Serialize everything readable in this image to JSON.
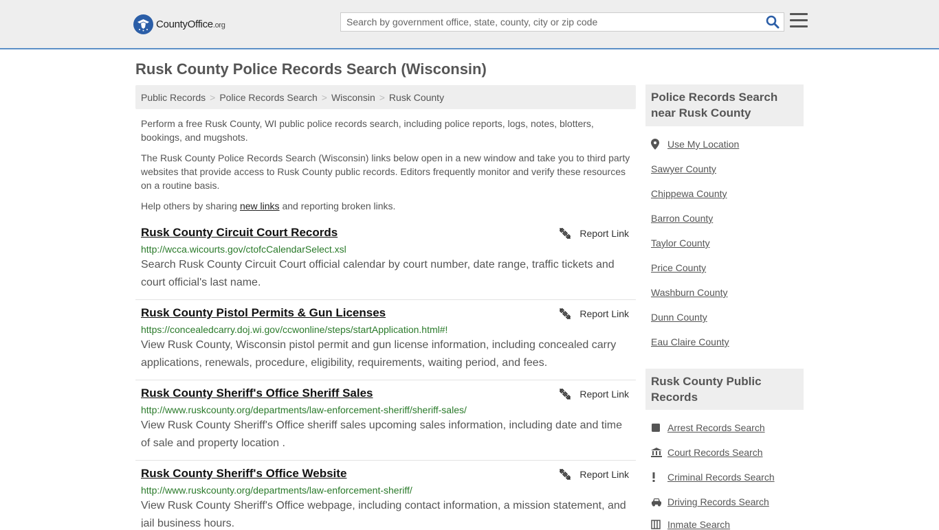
{
  "header": {
    "logo_text": "CountyOffice",
    "logo_suffix": ".org",
    "search_placeholder": "Search by government office, state, county, city or zip code"
  },
  "page_title": "Rusk County Police Records Search (Wisconsin)",
  "breadcrumb": [
    "Public Records",
    "Police Records Search",
    "Wisconsin",
    "Rusk County"
  ],
  "intro": {
    "p1": "Perform a free Rusk County, WI public police records search, including police reports, logs, notes, blotters, bookings, and mugshots.",
    "p2": "The Rusk County Police Records Search (Wisconsin) links below open in a new window and take you to third party websites that provide access to Rusk County public records. Editors frequently monitor and verify these resources on a routine basis.",
    "p3_before": "Help others by sharing ",
    "p3_link": "new links",
    "p3_after": " and reporting broken links."
  },
  "report_label": "Report Link",
  "results": [
    {
      "title": "Rusk County Circuit Court Records",
      "url": "http://wcca.wicourts.gov/ctofcCalendarSelect.xsl",
      "desc": "Search Rusk County Circuit Court official calendar by court number, date range, traffic tickets and court official's last name."
    },
    {
      "title": "Rusk County Pistol Permits & Gun Licenses",
      "url": "https://concealedcarry.doj.wi.gov/ccwonline/steps/startApplication.html#!",
      "desc": "View Rusk County, Wisconsin pistol permit and gun license information, including concealed carry applications, renewals, procedure, eligibility, requirements, waiting period, and fees."
    },
    {
      "title": "Rusk County Sheriff's Office Sheriff Sales",
      "url": "http://www.ruskcounty.org/departments/law-enforcement-sheriff/sheriff-sales/",
      "desc": "View Rusk County Sheriff's Office sheriff sales upcoming sales information, including date and time of sale and property location ."
    },
    {
      "title": "Rusk County Sheriff's Office Website",
      "url": "http://www.ruskcounty.org/departments/law-enforcement-sheriff/",
      "desc": "View Rusk County Sheriff's Office webpage, including contact information, a mission statement, and jail business hours."
    }
  ],
  "sidebar": {
    "nearby_title": "Police Records Search near Rusk County",
    "use_location": "Use My Location",
    "nearby": [
      "Sawyer County",
      "Chippewa County",
      "Barron County",
      "Taylor County",
      "Price County",
      "Washburn County",
      "Dunn County",
      "Eau Claire County"
    ],
    "public_title": "Rusk County Public Records",
    "public_links": [
      {
        "label": "Arrest Records Search",
        "icon": "arrest-icon"
      },
      {
        "label": "Court Records Search",
        "icon": "courthouse-icon"
      },
      {
        "label": "Criminal Records Search",
        "icon": "exclamation-icon"
      },
      {
        "label": "Driving Records Search",
        "icon": "car-icon"
      },
      {
        "label": "Inmate Search",
        "icon": "inmate-icon"
      }
    ]
  },
  "colors": {
    "header_bg": "#eeeeee",
    "header_border": "#5b8fc7",
    "url_green": "#2a7a2a",
    "search_icon": "#2b5ea7"
  }
}
